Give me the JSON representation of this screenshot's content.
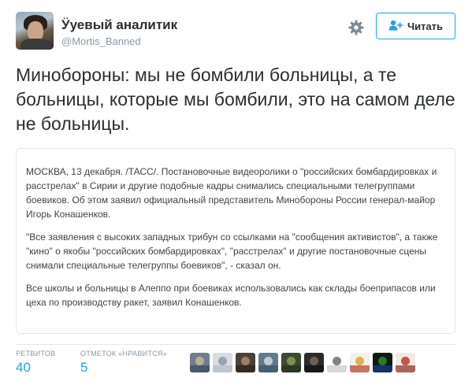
{
  "user": {
    "display_name": "Ӱуевый аналитик",
    "screen_name": "@Mortis_Banned"
  },
  "actions": {
    "follow_label": "Читать",
    "follow_icon": "follow-user-icon",
    "settings_icon": "gear-icon"
  },
  "tweet": {
    "text": "Минобороны: мы не бомбили больницы, а те больницы, которые мы бомбили, это на самом деле не больницы."
  },
  "quote": {
    "paragraphs": [
      "МОСКВА, 13 декабря. /ТАСС/. Постановочные видеоролики о \"российских бомбардировках и расстрелах\" в Сирии и другие подобные кадры снимались специальными телегруппами боевиков. Об этом заявил официальный представитель Минобороны России генерал-майор Игорь Конашенков.",
      "\"Все заявления с высоких западных трибун со ссылками на \"сообщения активистов\", а также \"кино\" о якобы \"российских бомбардировках\", \"расстрелах\" и другие постановочные сцены снимали специальные телегруппы боевиков\", - сказал он.",
      "Все школы и больницы в Алеппо при боевиках использовались как склады боеприпасов или цеха по производству ракет, заявил Конашенков."
    ]
  },
  "stats": {
    "retweets_label": "РЕТВИТОВ",
    "retweets_value": "40",
    "likes_label": "ОТМЕТОК «НРАВИТСЯ»",
    "likes_value": "5"
  },
  "liker_avatars": [
    {
      "bg": "#6f7d8c",
      "fg": "#c9b49a",
      "band": "#3b4a5a"
    },
    {
      "bg": "#d9dde2",
      "fg": "#8a99a8",
      "band": "#b0bcc7"
    },
    {
      "bg": "#4a4038",
      "fg": "#b08a6a",
      "band": "#2b2420"
    },
    {
      "bg": "#5f7a8c",
      "fg": "#cfd9e0",
      "band": "#3f5466"
    },
    {
      "bg": "#3d4a2e",
      "fg": "#8a9a5a",
      "band": "#27301c"
    },
    {
      "bg": "#2b2b2b",
      "fg": "#7a6a5a",
      "band": "#111111"
    },
    {
      "bg": "#ffffff",
      "fg": "#6d6d6d",
      "band": "#c8c8c8"
    },
    {
      "bg": "#f4f1ea",
      "fg": "#d9a63a",
      "band": "#b83a2a"
    },
    {
      "bg": "#0f1a10",
      "fg": "#2e8b3a",
      "band": "#1a3d8a"
    },
    {
      "bg": "#f1e9e6",
      "fg": "#c0392b",
      "band": "#8e2a20"
    }
  ]
}
